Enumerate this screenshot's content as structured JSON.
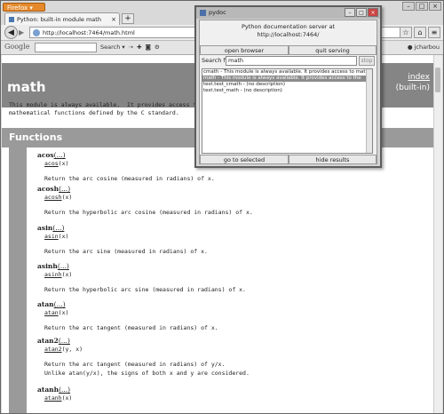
{
  "browser": {
    "menu_button": "Firefox ▾",
    "tab_title": "Python: built-in module math",
    "tab_close": "×",
    "new_tab": "+",
    "url": "http://localhost:7464/math.html",
    "search_engine": "Google",
    "search_button": "Search ▾",
    "user": "jcharbou"
  },
  "page": {
    "title": "math",
    "index_link": "index",
    "builtin_label": "(built-in)",
    "description_lines": [
      "This module is always available.  It provides access to the",
      "mathematical functions defined by the C standard."
    ],
    "section_title": "Functions",
    "functions": [
      {
        "name": "acos",
        "ellipsis": "(...)",
        "sig_name": "acos",
        "sig_args": "(x)",
        "doc": "Return the arc cosine (measured in radians) of x."
      },
      {
        "name": "acosh",
        "ellipsis": "(...)",
        "sig_name": "acosh",
        "sig_args": "(x)",
        "doc": "Return the hyperbolic arc cosine (measured in radians) of x."
      },
      {
        "name": "asin",
        "ellipsis": "(...)",
        "sig_name": "asin",
        "sig_args": "(x)",
        "doc": "Return the arc sine (measured in radians) of x."
      },
      {
        "name": "asinh",
        "ellipsis": "(...)",
        "sig_name": "asinh",
        "sig_args": "(x)",
        "doc": "Return the hyperbolic arc sine (measured in radians) of x."
      },
      {
        "name": "atan",
        "ellipsis": "(...)",
        "sig_name": "atan",
        "sig_args": "(x)",
        "doc": "Return the arc tangent (measured in radians) of x."
      },
      {
        "name": "atan2",
        "ellipsis": "(...)",
        "sig_name": "atan2",
        "sig_args": "(y, x)",
        "doc": "Return the arc tangent (measured in radians) of y/x.\nUnlike atan(y/x), the signs of both x and y are considered."
      },
      {
        "name": "atanh",
        "ellipsis": "(...)",
        "sig_name": "atanh",
        "sig_args": "(x)",
        "doc": ""
      }
    ]
  },
  "pydoc": {
    "window_title": "pydoc",
    "server_line1": "Python documentation server at",
    "server_line2": "http://localhost:7464/",
    "open_browser": "open browser",
    "quit_serving": "quit serving",
    "search_label": "Search for",
    "search_value": "math",
    "stop": "stop",
    "results": [
      "cmath - This module is always available. It provides access to mathematical",
      "math - This module is always available. It provides access to the",
      "test.test_cmath - (no description)",
      "test.test_math - (no description)"
    ],
    "selected_index": 1,
    "go_to_selected": "go to selected",
    "hide_results": "hide results"
  }
}
